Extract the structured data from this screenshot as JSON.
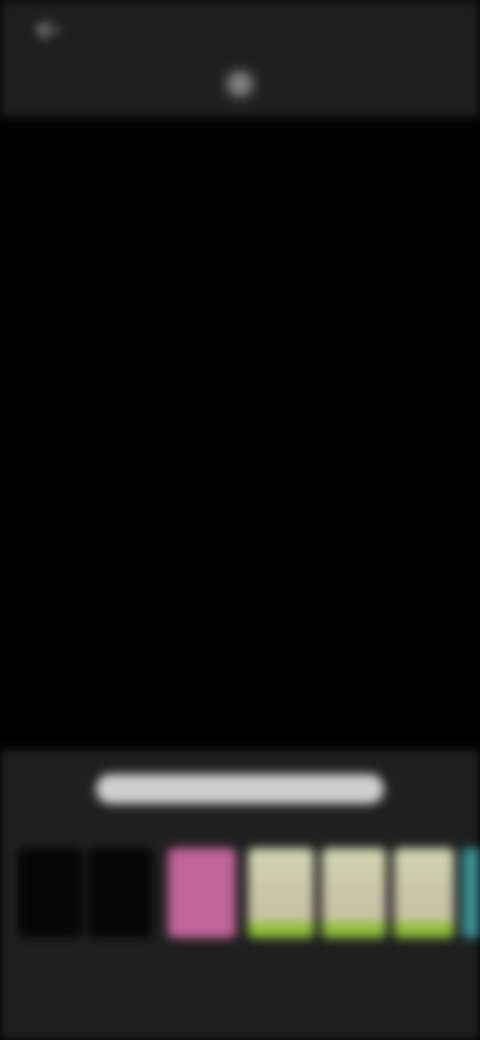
{
  "header": {
    "title": "",
    "back_icon": "back-arrow-icon",
    "center_icon": "sparkle-icon"
  },
  "adjust": {
    "value_fraction": 1.0
  },
  "filters": {
    "items": [
      {
        "name": "thumb-dark-1",
        "tone": "dark"
      },
      {
        "name": "thumb-dark-2",
        "tone": "dark"
      },
      {
        "name": "thumb-pink",
        "tone": "pink"
      },
      {
        "name": "thumb-green-1",
        "tone": "green"
      },
      {
        "name": "thumb-green-2",
        "tone": "green"
      },
      {
        "name": "thumb-green-3",
        "tone": "green"
      },
      {
        "name": "thumb-teal",
        "tone": "teal"
      }
    ]
  },
  "colors": {
    "topbar": "#1e1e1e",
    "canvas": "#000000",
    "panel": "#1f1f1f",
    "accent_green": "#8fbf3a",
    "pink": "#c0649a"
  }
}
